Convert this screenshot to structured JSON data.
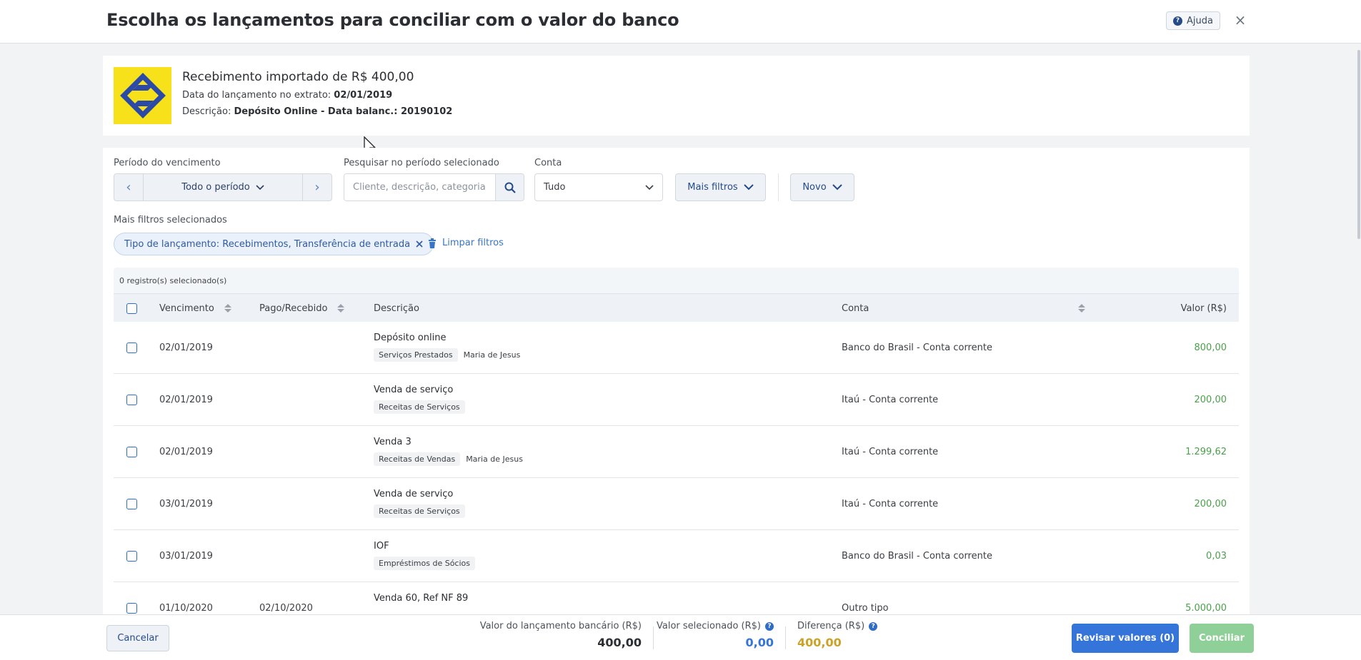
{
  "header": {
    "title": "Escolha os lançamentos para conciliar com o valor do banco",
    "help_label": "Ajuda",
    "close_glyph": "×"
  },
  "bank_entry": {
    "title": "Recebimento importado de R$ 400,00",
    "date_label": "Data do lançamento no extrato:",
    "date_value": "02/01/2019",
    "desc_label": "Descrição:",
    "desc_value": "Depósito Online - Data balanc.: 20190102",
    "logo_icon": "banco-do-brasil-logo",
    "logo_color": "#f7e11b",
    "logo_mark_color": "#2b4aa8"
  },
  "filters": {
    "period_label": "Período do vencimento",
    "period_value": "Todo o período",
    "search_label": "Pesquisar no período selecionado",
    "search_placeholder": "Cliente, descrição, categoria",
    "account_label": "Conta",
    "account_value": "Tudo",
    "more_filters_label": "Mais filtros",
    "new_label": "Novo",
    "selected_filters_label": "Mais filtros selecionados",
    "chip_label": "Tipo de lançamento: Recebimentos, Transferência de entrada",
    "clear_label": "Limpar filtros"
  },
  "table": {
    "selected_count": "0 registro(s) selecionado(s)",
    "columns": {
      "due": "Vencimento",
      "paid": "Pago/Recebido",
      "description": "Descrição",
      "account": "Conta",
      "value": "Valor (R$)"
    },
    "rows": [
      {
        "due": "02/01/2019",
        "paid": "",
        "description": "Depósito online",
        "category": "Serviços Prestados",
        "person": "Maria de Jesus",
        "account": "Banco do Brasil - Conta corrente",
        "value": "800,00"
      },
      {
        "due": "02/01/2019",
        "paid": "",
        "description": "Venda de serviço",
        "category": "Receitas de Serviços",
        "person": "",
        "account": "Itaú - Conta corrente",
        "value": "200,00"
      },
      {
        "due": "02/01/2019",
        "paid": "",
        "description": "Venda 3",
        "category": "Receitas de Vendas",
        "person": "Maria de Jesus",
        "account": "Itaú - Conta corrente",
        "value": "1.299,62"
      },
      {
        "due": "03/01/2019",
        "paid": "",
        "description": "Venda de serviço",
        "category": "Receitas de Serviços",
        "person": "",
        "account": "Itaú - Conta corrente",
        "value": "200,00"
      },
      {
        "due": "03/01/2019",
        "paid": "",
        "description": "IOF",
        "category": "Empréstimos de Sócios",
        "person": "",
        "account": "Banco do Brasil - Conta corrente",
        "value": "0,03"
      },
      {
        "due": "01/10/2020",
        "paid": "02/10/2020",
        "description": "Venda 60, Ref NF 89",
        "category": "",
        "person": "",
        "account": "Outro tipo",
        "value": "5.000,00"
      }
    ],
    "value_color": "#4aa14a"
  },
  "footer": {
    "cancel_label": "Cancelar",
    "bank_value_label": "Valor do lançamento bancário (R$)",
    "bank_value": "400,00",
    "selected_value_label": "Valor selecionado (R$)",
    "selected_value": "0,00",
    "difference_label": "Diferença (R$)",
    "difference_value": "400,00",
    "review_label": "Revisar valores (0)",
    "conciliar_label": "Conciliar",
    "colors": {
      "selected": "#3575d9",
      "difference": "#c9a227",
      "primary": "#3575d9",
      "success_disabled": "#8fcf98"
    }
  }
}
